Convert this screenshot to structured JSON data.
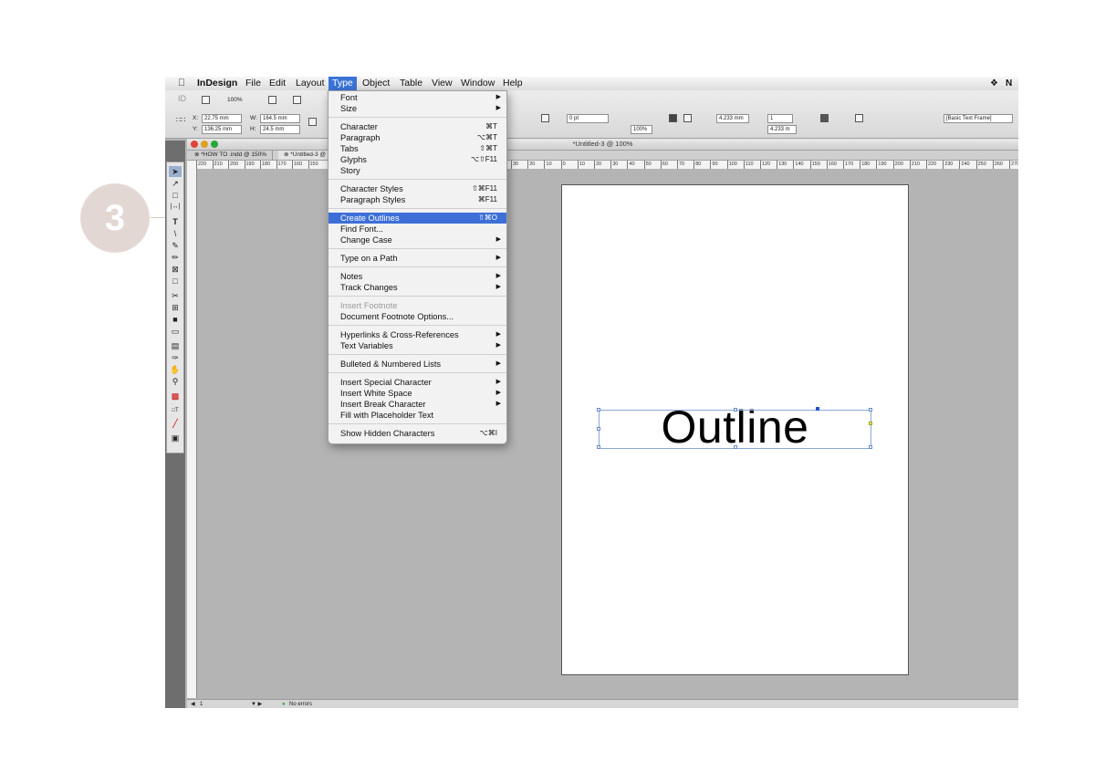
{
  "step": {
    "number": "3"
  },
  "menubar": {
    "apple": "",
    "items": [
      "InDesign",
      "File",
      "Edit",
      "Layout",
      "Type",
      "Object",
      "Table",
      "View",
      "Window",
      "Help"
    ],
    "active": "Type"
  },
  "control": {
    "zoom": "100%",
    "x": "22.75 mm",
    "y": "136.25 mm",
    "w": "164.5 mm",
    "h": "24.5 mm",
    "stroke": "0 pt",
    "scale": "100%",
    "inset1": "4.233 mm",
    "inset2": "4.233 m",
    "cols": "1",
    "frame_style": "[Basic Text Frame]"
  },
  "document": {
    "title": "*Untitled-3 @ 100%",
    "tabs": [
      "*HOW TO .indd @ 150%",
      "*Untitled-3 @"
    ],
    "ruler_left": [
      "220",
      "210",
      "200",
      "190",
      "180",
      "170",
      "160",
      "150"
    ],
    "ruler_right": [
      "30",
      "20",
      "10",
      "0",
      "10",
      "20",
      "30",
      "40",
      "50",
      "60",
      "70",
      "80",
      "90",
      "100",
      "110",
      "120",
      "130",
      "140",
      "150",
      "160",
      "170",
      "180",
      "190",
      "200",
      "210",
      "220",
      "230",
      "240",
      "250",
      "260",
      "270"
    ],
    "status": {
      "page": "1",
      "errors": "No errors"
    },
    "frame_text": "Outline"
  },
  "type_menu": {
    "items": [
      {
        "label": "Font",
        "arrow": true
      },
      {
        "label": "Size",
        "arrow": true
      },
      {
        "sep": true
      },
      {
        "label": "Character",
        "shortcut": "⌘T"
      },
      {
        "label": "Paragraph",
        "shortcut": "⌥⌘T"
      },
      {
        "label": "Tabs",
        "shortcut": "⇧⌘T"
      },
      {
        "label": "Glyphs",
        "shortcut": "⌥⇧F11"
      },
      {
        "label": "Story"
      },
      {
        "sep": true
      },
      {
        "label": "Character Styles",
        "shortcut": "⇧⌘F11"
      },
      {
        "label": "Paragraph Styles",
        "shortcut": "⌘F11"
      },
      {
        "sep": true
      },
      {
        "label": "Create Outlines",
        "shortcut": "⇧⌘O",
        "highlight": true
      },
      {
        "label": "Find Font..."
      },
      {
        "label": "Change Case",
        "arrow": true
      },
      {
        "sep": true
      },
      {
        "label": "Type on a Path",
        "arrow": true
      },
      {
        "sep": true
      },
      {
        "label": "Notes",
        "arrow": true
      },
      {
        "label": "Track Changes",
        "arrow": true
      },
      {
        "sep": true
      },
      {
        "label": "Insert Footnote",
        "disabled": true
      },
      {
        "label": "Document Footnote Options..."
      },
      {
        "sep": true
      },
      {
        "label": "Hyperlinks & Cross-References",
        "arrow": true
      },
      {
        "label": "Text Variables",
        "arrow": true
      },
      {
        "sep": true
      },
      {
        "label": "Bulleted & Numbered Lists",
        "arrow": true
      },
      {
        "sep": true
      },
      {
        "label": "Insert Special Character",
        "arrow": true
      },
      {
        "label": "Insert White Space",
        "arrow": true
      },
      {
        "label": "Insert Break Character",
        "arrow": true
      },
      {
        "label": "Fill with Placeholder Text"
      },
      {
        "sep": true
      },
      {
        "label": "Show Hidden Characters",
        "shortcut": "⌥⌘I"
      }
    ]
  },
  "colors": {
    "highlight": "#3d6fd7",
    "step_badge": "#e2d7d2"
  }
}
